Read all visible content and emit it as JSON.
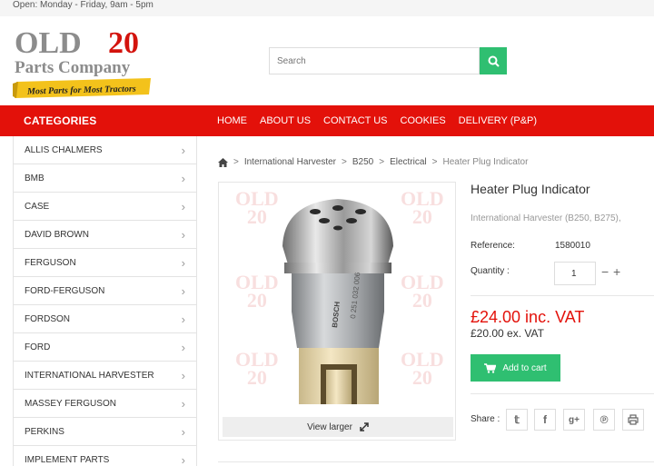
{
  "topbar": {
    "hours": "Open: Monday - Friday, 9am - 5pm"
  },
  "logo": {
    "line1_old": "OLD",
    "line1_num": "20",
    "line2": "Parts Company",
    "ribbon": "Most Parts for Most Tractors"
  },
  "search": {
    "placeholder": "Search",
    "icon": "search-icon"
  },
  "nav": {
    "categories_label": "CATEGORIES",
    "links": [
      "HOME",
      "ABOUT US",
      "CONTACT US",
      "COOKIES",
      "DELIVERY (P&P)"
    ]
  },
  "sidebar": {
    "items": [
      "ALLIS CHALMERS",
      "BMB",
      "CASE",
      "DAVID BROWN",
      "FERGUSON",
      "FORD-FERGUSON",
      "FORDSON",
      "FORD",
      "INTERNATIONAL HARVESTER",
      "MASSEY FERGUSON",
      "PERKINS",
      "IMPLEMENT PARTS"
    ]
  },
  "breadcrumb": {
    "home_icon": "home-icon",
    "items": [
      "International Harvester",
      "B250",
      "Electrical"
    ],
    "current": "Heater Plug Indicator"
  },
  "product": {
    "title": "Heater Plug Indicator",
    "compatibility": "International Harvester (B250, B275),",
    "reference_label": "Reference:",
    "reference_value": "1580010",
    "quantity_label": "Quantity :",
    "quantity_value": "1",
    "price_inc_vat": "£24.00 inc. VAT",
    "price_ex_vat": "£20.00 ex. VAT",
    "add_to_cart": "Add to cart",
    "view_larger": "View larger",
    "watermark_old": "OLD",
    "watermark_num": "20"
  },
  "share": {
    "label": "Share :",
    "buttons": [
      "twitter-icon",
      "facebook-icon",
      "google-plus-icon",
      "pinterest-icon",
      "print-icon"
    ]
  },
  "colors": {
    "brand_red": "#e3110a",
    "accent_green": "#2fbf71"
  }
}
